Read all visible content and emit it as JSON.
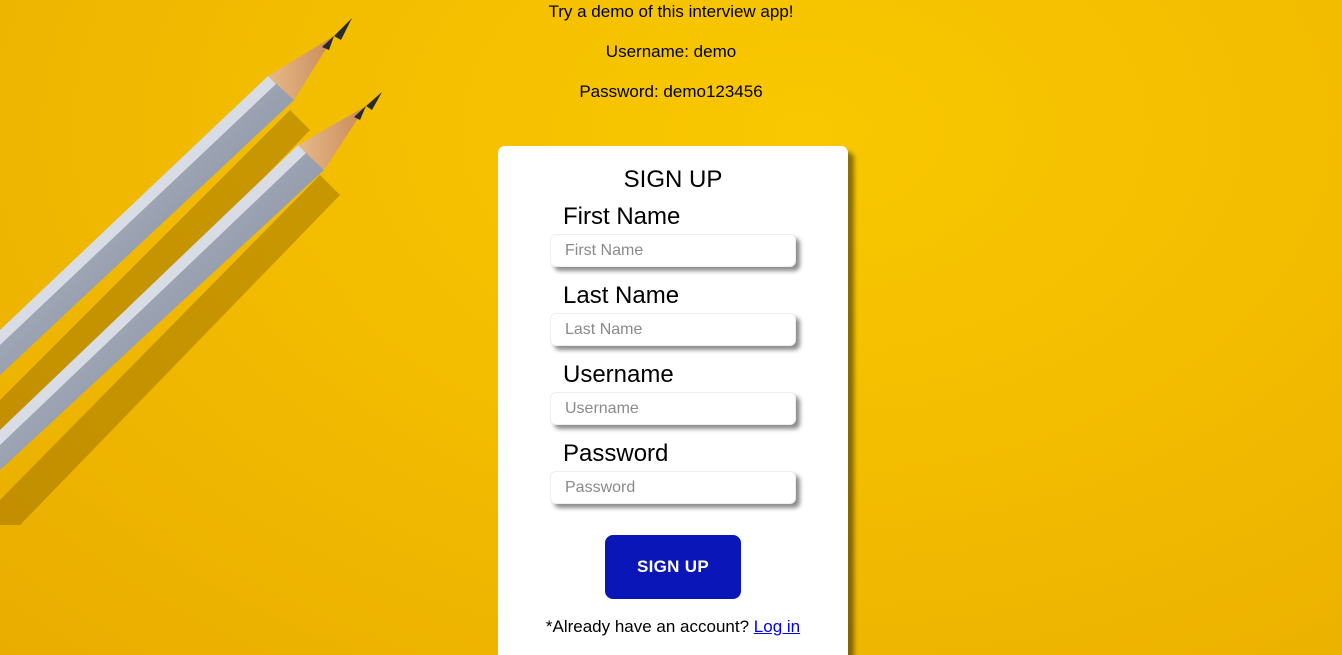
{
  "demo": {
    "title": "Try a demo of this interview app!",
    "username_line": "Username: demo",
    "password_line": "Password: demo123456"
  },
  "form": {
    "title": "SIGN UP",
    "fields": [
      {
        "label": "First Name",
        "placeholder": "First Name"
      },
      {
        "label": "Last Name",
        "placeholder": "Last Name"
      },
      {
        "label": "Username",
        "placeholder": "Username"
      },
      {
        "label": "Password",
        "placeholder": "Password"
      }
    ],
    "submit_label": "SIGN UP",
    "login_prompt": "*Already have an account?",
    "login_link": "Log in"
  },
  "colors": {
    "background": "#f3bd00",
    "button": "#0b16b8",
    "link": "#0000ee"
  },
  "icons": {
    "background_art": "pencils"
  }
}
